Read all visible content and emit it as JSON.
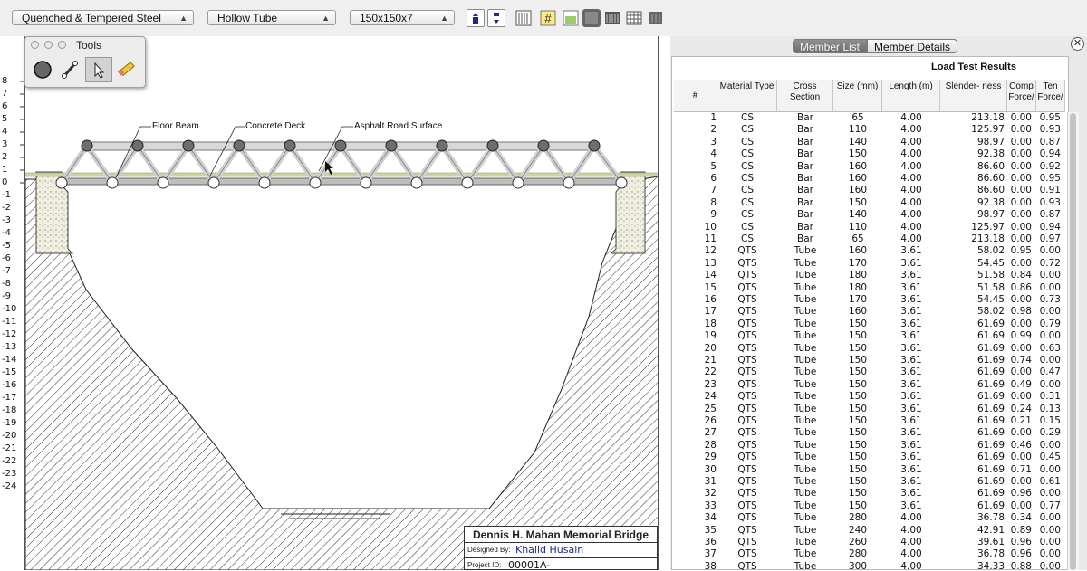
{
  "toolbar": {
    "material_select": "Quenched & Tempered Steel",
    "section_select": "Hollow Tube",
    "size_select": "150x150x7"
  },
  "canvas": {
    "y_ticks": [
      "8",
      "7",
      "6",
      "5",
      "4",
      "3",
      "2",
      "1",
      "0",
      "-1",
      "-2",
      "-3",
      "-4",
      "-5",
      "-6",
      "-7",
      "-8",
      "-9",
      "-10",
      "-11",
      "-12",
      "-13",
      "-14",
      "-15",
      "-16",
      "-17",
      "-18",
      "-19",
      "-20",
      "-21",
      "-22",
      "-23",
      "-24"
    ],
    "labels": {
      "floor_beam": "Floor Beam",
      "concrete_deck": "Concrete Deck",
      "asphalt": "Asphalt Road Surface"
    }
  },
  "tools_palette": {
    "title": "Tools",
    "tools": [
      "joint-tool",
      "member-tool",
      "select-tool",
      "eraser-tool"
    ],
    "active_tool": "select-tool"
  },
  "title_block": {
    "bridge_name": "Dennis H. Mahan Memorial Bridge",
    "designed_by_label": "Designed By:",
    "designed_by": "Khalid Husain",
    "project_id_label": "Project ID:",
    "project_id": "00001A-"
  },
  "panel": {
    "tabs": [
      {
        "label": "Member List",
        "active": true
      },
      {
        "label": "Member Details",
        "active": false
      }
    ],
    "results_title": "Load Test Results",
    "columns": [
      "#",
      "Material Type",
      "Cross Section",
      "Size (mm)",
      "Length (m)",
      "Slender- ness",
      "Comp Force/",
      "Ten Force/"
    ],
    "rows": [
      [
        "1",
        "CS",
        "Bar",
        "65",
        "4.00",
        "213.18",
        "0.00",
        "0.95"
      ],
      [
        "2",
        "CS",
        "Bar",
        "110",
        "4.00",
        "125.97",
        "0.00",
        "0.93"
      ],
      [
        "3",
        "CS",
        "Bar",
        "140",
        "4.00",
        "98.97",
        "0.00",
        "0.87"
      ],
      [
        "4",
        "CS",
        "Bar",
        "150",
        "4.00",
        "92.38",
        "0.00",
        "0.94"
      ],
      [
        "5",
        "CS",
        "Bar",
        "160",
        "4.00",
        "86.60",
        "0.00",
        "0.92"
      ],
      [
        "6",
        "CS",
        "Bar",
        "160",
        "4.00",
        "86.60",
        "0.00",
        "0.95"
      ],
      [
        "7",
        "CS",
        "Bar",
        "160",
        "4.00",
        "86.60",
        "0.00",
        "0.91"
      ],
      [
        "8",
        "CS",
        "Bar",
        "150",
        "4.00",
        "92.38",
        "0.00",
        "0.93"
      ],
      [
        "9",
        "CS",
        "Bar",
        "140",
        "4.00",
        "98.97",
        "0.00",
        "0.87"
      ],
      [
        "10",
        "CS",
        "Bar",
        "110",
        "4.00",
        "125.97",
        "0.00",
        "0.94"
      ],
      [
        "11",
        "CS",
        "Bar",
        "65",
        "4.00",
        "213.18",
        "0.00",
        "0.97"
      ],
      [
        "12",
        "QTS",
        "Tube",
        "160",
        "3.61",
        "58.02",
        "0.95",
        "0.00"
      ],
      [
        "13",
        "QTS",
        "Tube",
        "170",
        "3.61",
        "54.45",
        "0.00",
        "0.72"
      ],
      [
        "14",
        "QTS",
        "Tube",
        "180",
        "3.61",
        "51.58",
        "0.84",
        "0.00"
      ],
      [
        "15",
        "QTS",
        "Tube",
        "180",
        "3.61",
        "51.58",
        "0.86",
        "0.00"
      ],
      [
        "16",
        "QTS",
        "Tube",
        "170",
        "3.61",
        "54.45",
        "0.00",
        "0.73"
      ],
      [
        "17",
        "QTS",
        "Tube",
        "160",
        "3.61",
        "58.02",
        "0.98",
        "0.00"
      ],
      [
        "18",
        "QTS",
        "Tube",
        "150",
        "3.61",
        "61.69",
        "0.00",
        "0.79"
      ],
      [
        "19",
        "QTS",
        "Tube",
        "150",
        "3.61",
        "61.69",
        "0.99",
        "0.00"
      ],
      [
        "20",
        "QTS",
        "Tube",
        "150",
        "3.61",
        "61.69",
        "0.00",
        "0.63"
      ],
      [
        "21",
        "QTS",
        "Tube",
        "150",
        "3.61",
        "61.69",
        "0.74",
        "0.00"
      ],
      [
        "22",
        "QTS",
        "Tube",
        "150",
        "3.61",
        "61.69",
        "0.00",
        "0.47"
      ],
      [
        "23",
        "QTS",
        "Tube",
        "150",
        "3.61",
        "61.69",
        "0.49",
        "0.00"
      ],
      [
        "24",
        "QTS",
        "Tube",
        "150",
        "3.61",
        "61.69",
        "0.00",
        "0.31"
      ],
      [
        "25",
        "QTS",
        "Tube",
        "150",
        "3.61",
        "61.69",
        "0.24",
        "0.13"
      ],
      [
        "26",
        "QTS",
        "Tube",
        "150",
        "3.61",
        "61.69",
        "0.21",
        "0.15"
      ],
      [
        "27",
        "QTS",
        "Tube",
        "150",
        "3.61",
        "61.69",
        "0.00",
        "0.29"
      ],
      [
        "28",
        "QTS",
        "Tube",
        "150",
        "3.61",
        "61.69",
        "0.46",
        "0.00"
      ],
      [
        "29",
        "QTS",
        "Tube",
        "150",
        "3.61",
        "61.69",
        "0.00",
        "0.45"
      ],
      [
        "30",
        "QTS",
        "Tube",
        "150",
        "3.61",
        "61.69",
        "0.71",
        "0.00"
      ],
      [
        "31",
        "QTS",
        "Tube",
        "150",
        "3.61",
        "61.69",
        "0.00",
        "0.61"
      ],
      [
        "32",
        "QTS",
        "Tube",
        "150",
        "3.61",
        "61.69",
        "0.96",
        "0.00"
      ],
      [
        "33",
        "QTS",
        "Tube",
        "150",
        "3.61",
        "61.69",
        "0.00",
        "0.77"
      ],
      [
        "34",
        "QTS",
        "Tube",
        "280",
        "4.00",
        "36.78",
        "0.34",
        "0.00"
      ],
      [
        "35",
        "QTS",
        "Tube",
        "240",
        "4.00",
        "42.91",
        "0.89",
        "0.00"
      ],
      [
        "36",
        "QTS",
        "Tube",
        "260",
        "4.00",
        "39.61",
        "0.96",
        "0.00"
      ],
      [
        "37",
        "QTS",
        "Tube",
        "280",
        "4.00",
        "36.78",
        "0.96",
        "0.00"
      ],
      [
        "38",
        "QTS",
        "Tube",
        "300",
        "4.00",
        "34.33",
        "0.88",
        "0.00"
      ]
    ]
  },
  "colors": {
    "accent_blue": "#1a2a8a",
    "joint_fill": "#6e6e6e",
    "deck_green": "#c9d79a",
    "tab_active": "#7a7a7a"
  }
}
